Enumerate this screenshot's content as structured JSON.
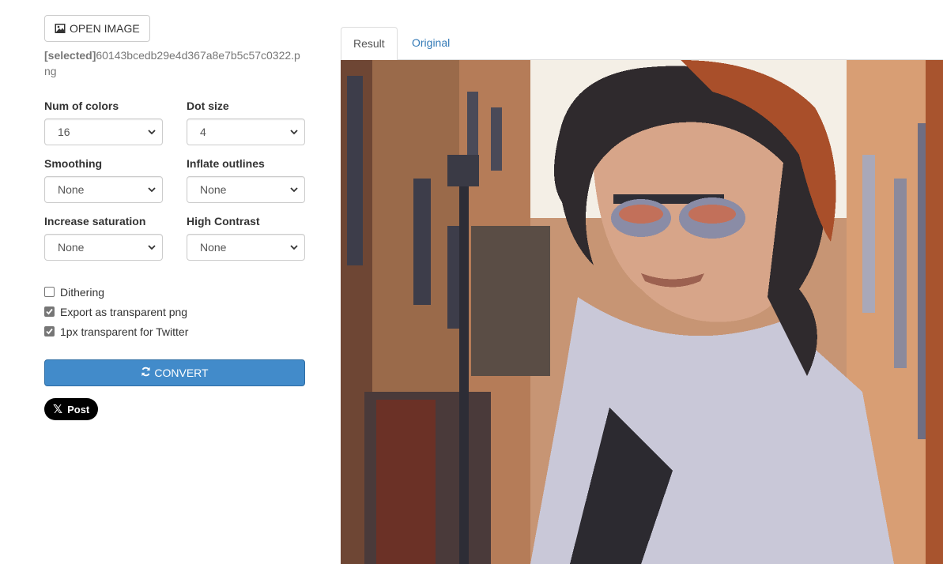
{
  "controls": {
    "open_image_label": "OPEN IMAGE",
    "selected_prefix": "[selected]",
    "selected_filename": "60143bcedb29e4d367a8e7b5c57c0322.png",
    "fields": [
      {
        "label": "Num of colors",
        "value": "16"
      },
      {
        "label": "Dot size",
        "value": "4"
      },
      {
        "label": "Smoothing",
        "value": "None"
      },
      {
        "label": "Inflate outlines",
        "value": "None"
      },
      {
        "label": "Increase saturation",
        "value": "None"
      },
      {
        "label": "High Contrast",
        "value": "None"
      }
    ],
    "checkboxes": [
      {
        "label": "Dithering",
        "checked": false
      },
      {
        "label": "Export as transparent png",
        "checked": true
      },
      {
        "label": "1px transparent for Twitter",
        "checked": true
      }
    ],
    "convert_label": "CONVERT",
    "post_label": "Post"
  },
  "tabs": [
    {
      "label": "Result",
      "active": true
    },
    {
      "label": "Original",
      "active": false
    }
  ],
  "colors": {
    "primary": "#428bca",
    "link": "#337ab7",
    "muted": "#777777"
  },
  "icons": {
    "open_image": "image-icon",
    "convert": "refresh-icon",
    "post": "x-logo-icon",
    "select": "chevron-down-icon"
  }
}
